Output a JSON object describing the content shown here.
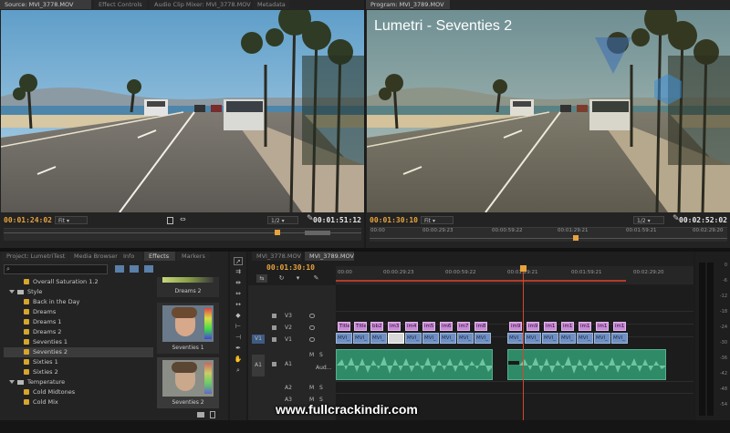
{
  "source_panel": {
    "tabs": [
      "Source: MVI_3778.MOV",
      "Effect Controls",
      "Audio Clip Mixer: MVI_3778.MOV",
      "Metadata"
    ],
    "timecode_in": "00:01:24:02",
    "zoom": "Fit",
    "resolution": "1/2",
    "duration": "00:01:51:12"
  },
  "program_panel": {
    "tab": "Program: MVI_3789.MOV",
    "overlay_title": "Lumetri - Seventies 2",
    "timecode_in": "00:01:30:10",
    "zoom": "Fit",
    "resolution": "1/2",
    "duration": "00:02:52:02",
    "ruler": [
      "00:00",
      "00:00:29:23",
      "00:00:59:22",
      "00:01:29:21",
      "00:01:59:21",
      "00:02:29:20"
    ]
  },
  "project_panel": {
    "tabs": [
      "Project: LumetriTest",
      "Media Browser",
      "Info",
      "Effects",
      "Markers"
    ],
    "active_tab": "Effects",
    "items": [
      {
        "label": "Overall Saturation 1.2",
        "kind": "fx"
      },
      {
        "label": "Style",
        "kind": "folder"
      },
      {
        "label": "Back in the Day",
        "kind": "fx"
      },
      {
        "label": "Dreams",
        "kind": "fx"
      },
      {
        "label": "Dreams 1",
        "kind": "fx"
      },
      {
        "label": "Dreams 2",
        "kind": "fx"
      },
      {
        "label": "Seventies 1",
        "kind": "fx"
      },
      {
        "label": "Seventies 2",
        "kind": "fx",
        "selected": true
      },
      {
        "label": "Sixties 1",
        "kind": "fx"
      },
      {
        "label": "Sixties 2",
        "kind": "fx"
      },
      {
        "label": "Temperature",
        "kind": "folder"
      },
      {
        "label": "Cold Midtones",
        "kind": "fx"
      },
      {
        "label": "Cold Mix",
        "kind": "fx"
      }
    ],
    "previews": [
      "Dreams 2",
      "Seventies 1",
      "Seventies 2"
    ]
  },
  "timeline": {
    "tabs": [
      "MVI_3778.MOV",
      "MVI_3789.MOV"
    ],
    "timecode": "00:01:30:10",
    "ruler": [
      "00:00",
      "00:00:29:23",
      "00:00:59:22",
      "00:01:29:21",
      "00:01:59:21",
      "00:02:29:20"
    ],
    "tracks": {
      "v3": "V3",
      "v2": "V2",
      "v1": "V1",
      "a1": "A1",
      "a2": "A2",
      "a3": "A3",
      "src_v1": "V1",
      "src_a1": "A1",
      "a1_name": "Aud...",
      "m": "M",
      "s": "S"
    },
    "v2_clips_group1": [
      "Title",
      "Title",
      "bb2",
      "im3",
      "im4",
      "im5",
      "im6",
      "im7",
      "im8"
    ],
    "v2_clips_group2": [
      "im9",
      "im9",
      "im1",
      "im1",
      "im1",
      "im1",
      "im1"
    ],
    "v1_clip_label": "MVI_"
  },
  "meter_scale": [
    "0",
    "-6",
    "-12",
    "-18",
    "-24",
    "-30",
    "-36",
    "-42",
    "-48",
    "-54"
  ],
  "watermark": "www.fullcrackindir.com"
}
